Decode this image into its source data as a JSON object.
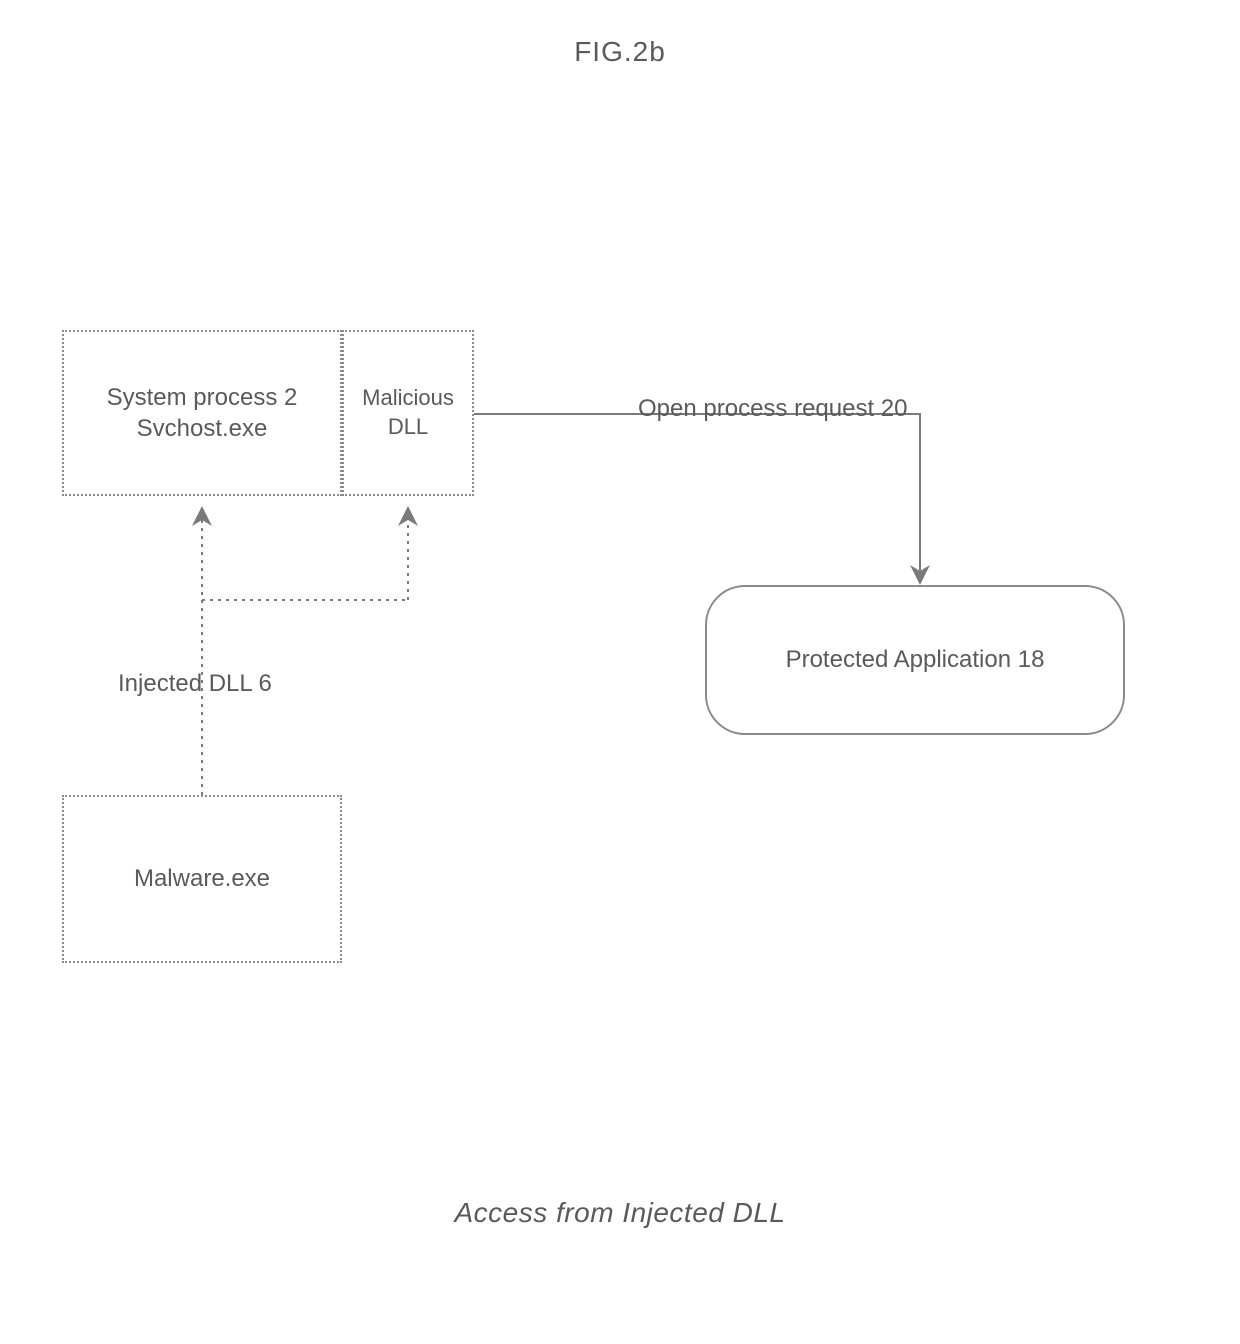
{
  "figure_label": "FIG.2b",
  "caption": "Access from Injected DLL",
  "boxes": {
    "system_process": {
      "line1": "System process 2",
      "line2": "Svchost.exe"
    },
    "malicious_dll": {
      "line1": "Malicious",
      "line2": "DLL"
    },
    "malware": "Malware.exe",
    "protected_app": "Protected Application  18"
  },
  "edge_labels": {
    "injected_dll": "Injected DLL 6",
    "open_process": "Open process request 20"
  }
}
